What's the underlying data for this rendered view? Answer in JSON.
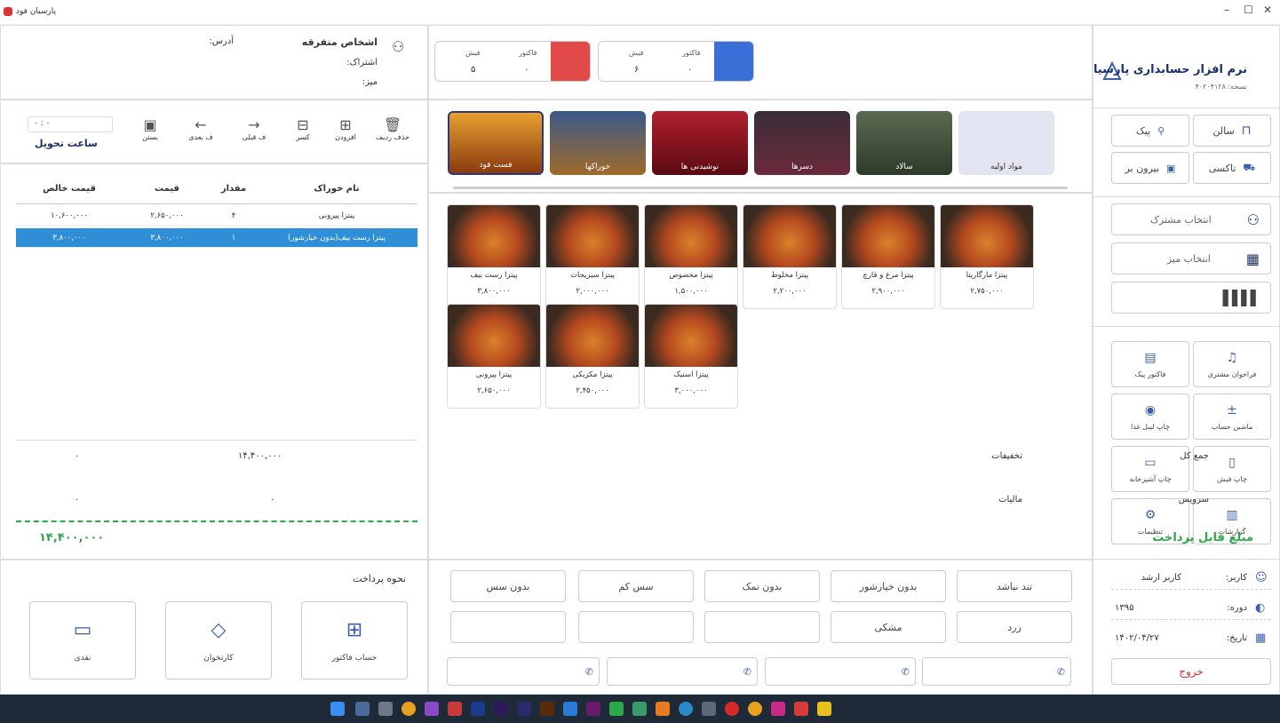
{
  "window": {
    "title": "پارسیان فود",
    "min": "–",
    "max": "☐",
    "close": "✕"
  },
  "brand": {
    "title": "نرم افزار حسابداری پارسیان",
    "version": "نسخه: ۴۰۲۰۴۱۲۸"
  },
  "modes": [
    {
      "label": "سالن"
    },
    {
      "label": "پیک"
    },
    {
      "label": "تاکسی"
    },
    {
      "label": "بیرون بر"
    }
  ],
  "selectors": {
    "customer": "انتخاب مشترک",
    "table": "انتخاب میز"
  },
  "actions": [
    {
      "label": "فراخوان مشتری"
    },
    {
      "label": "فاکتور پیک"
    },
    {
      "label": "ماشین حساب"
    },
    {
      "label": "چاپ لیبل غذا"
    },
    {
      "label": "چاپ فیش"
    },
    {
      "label": "چاپ آشپزخانه"
    },
    {
      "label": "گزارشات"
    },
    {
      "label": "تنظیمات"
    }
  ],
  "user": {
    "user_label": "کاربر:",
    "user_value": "کاربر ارشد",
    "period_label": "دوره:",
    "period_value": "۱۳۹۵",
    "date_label": "تاریخ:",
    "date_value": "۱۴۰۲/۰۴/۲۷",
    "exit": "خروج"
  },
  "counters": [
    {
      "receipt_label": "فیش",
      "receipt_value": "۶",
      "invoice_label": "فاکتور",
      "invoice_value": "۰"
    },
    {
      "receipt_label": "فیش",
      "receipt_value": "۵",
      "invoice_label": "فاکتور",
      "invoice_value": "۰"
    }
  ],
  "categories": [
    {
      "name": "مواد اولیه"
    },
    {
      "name": "سالاد"
    },
    {
      "name": "دسرها"
    },
    {
      "name": "نوشیدنی ها"
    },
    {
      "name": "خوراکها"
    },
    {
      "name": "فست فود"
    }
  ],
  "products": [
    {
      "name": "پیتزا مارگاریتا",
      "price": "۲,۷۵۰,۰۰۰"
    },
    {
      "name": "پیتزا مرغ و قارچ",
      "price": "۲,۹۰۰,۰۰۰"
    },
    {
      "name": "پیتزا مخلوط",
      "price": "۲,۲۰۰,۰۰۰"
    },
    {
      "name": "پیتزا مخصوص",
      "price": "۱,۵۰۰,۰۰۰"
    },
    {
      "name": "پیتزا سبزیجات",
      "price": "۲,۰۰۰,۰۰۰"
    },
    {
      "name": "پیتزا رست بیف",
      "price": "۳,۸۰۰,۰۰۰"
    },
    {
      "name": "پیتزا استیک",
      "price": "۳,۰۰۰,۰۰۰"
    },
    {
      "name": "پیتزا مکزیکی",
      "price": "۲,۴۵۰,۰۰۰"
    },
    {
      "name": "پیتزا پپرونی",
      "price": "۲,۶۵۰,۰۰۰"
    }
  ],
  "notes": [
    "تند نباشد",
    "بدون خیارشور",
    "بدون نمک",
    "سس کم",
    "بدون سس",
    "زرد",
    "مشکی"
  ],
  "customer": {
    "title": "اشخاص متفرقه",
    "address_label": "آدرس:",
    "sub_label": "اشتراک:",
    "table_label": "میز:"
  },
  "toolbar": [
    {
      "label": "حذف ردیف"
    },
    {
      "label": "افزودن"
    },
    {
      "label": "کسر"
    },
    {
      "label": "ف قبلی"
    },
    {
      "label": "ف بعدی"
    },
    {
      "label": "بستن"
    }
  ],
  "delivery": {
    "label": "ساعت تحویل",
    "value": "۰ : ۰"
  },
  "order": {
    "headers": [
      "نام خوراک",
      "مقدار",
      "قیمت",
      "قیمت خالص"
    ],
    "rows": [
      [
        "پیتزا پپرونی",
        "۴",
        "۲,۶۵۰,۰۰۰",
        "۱۰,۶۰۰,۰۰۰"
      ],
      [
        "پیتزا رست بیف(بدون خیارشور)",
        "۱",
        "۳,۸۰۰,۰۰۰",
        "۳,۸۰۰,۰۰۰"
      ]
    ]
  },
  "totals": {
    "sum_label": "جمع کل",
    "sum_value": "۱۴,۴۰۰,۰۰۰",
    "discount_label": "تخفیفات",
    "discount_value": "۰",
    "service_label": "سرویس",
    "service_value": "۰",
    "tax_label": "مالیات",
    "tax_value": "۰",
    "pay_label": "مبلغ قابل پرداخت",
    "pay_value": "۱۴,۴۰۰,۰۰۰"
  },
  "payment": {
    "title": "نحوه پرداخت",
    "methods": [
      {
        "label": "حساب فاکتور"
      },
      {
        "label": "کارتخوان"
      },
      {
        "label": "نقدی"
      }
    ]
  },
  "colors": {
    "accent": "#3a5fa8",
    "selected_row": "#2e8fd6",
    "green": "#2aa84a",
    "delivery_card": "#3a6fd8",
    "salon_card": "#e24a4a"
  }
}
